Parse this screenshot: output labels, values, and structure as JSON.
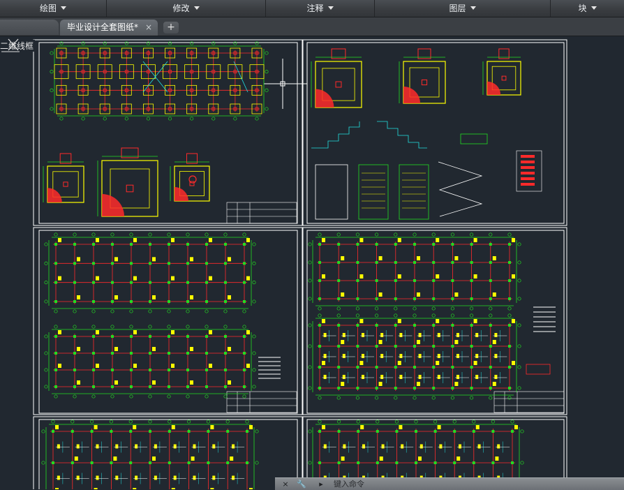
{
  "menubar": {
    "items": [
      {
        "label": "绘图"
      },
      {
        "label": "修改"
      },
      {
        "label": "注释"
      },
      {
        "label": "图层"
      },
      {
        "label": "块"
      }
    ]
  },
  "tabs": {
    "active_label": "毕业设计全套图纸*",
    "close_symbol": "×",
    "new_symbol": "+"
  },
  "viewport": {
    "view_label": "二维线框",
    "background_color": "#212830"
  },
  "commandline": {
    "close_symbol": "×",
    "settings_symbol": "🔧",
    "recent_symbol": "▸",
    "prompt": "键入命令"
  },
  "colors": {
    "frame": "#ffffff",
    "grid_red": "#ff2a2a",
    "dim_green": "#22dd22",
    "column_yellow": "#ffff00",
    "highlight_cyan": "#22e0e0"
  }
}
